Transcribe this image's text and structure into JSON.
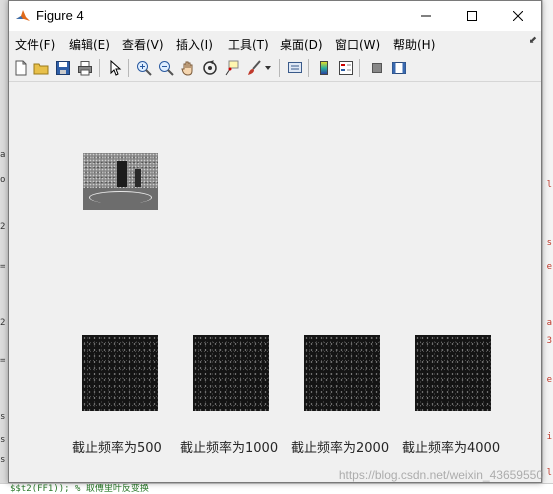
{
  "window": {
    "title": "Figure 4"
  },
  "menu": [
    {
      "label": "文件(F)"
    },
    {
      "label": "编辑(E)"
    },
    {
      "label": "查看(V)"
    },
    {
      "label": "插入(I)"
    },
    {
      "label": "工具(T)"
    },
    {
      "label": "桌面(D)"
    },
    {
      "label": "窗口(W)"
    },
    {
      "label": "帮助(H)"
    }
  ],
  "toolbar": [
    {
      "icon": "new-figure-icon"
    },
    {
      "icon": "open-file-icon"
    },
    {
      "icon": "save-icon"
    },
    {
      "icon": "print-icon"
    },
    {
      "icon": "edit-plot-pointer-icon"
    },
    {
      "icon": "zoom-in-icon"
    },
    {
      "icon": "zoom-out-icon"
    },
    {
      "icon": "pan-hand-icon"
    },
    {
      "icon": "rotate-3d-icon"
    },
    {
      "icon": "data-cursor-icon"
    },
    {
      "icon": "brush-icon"
    },
    {
      "icon": "link-plot-icon"
    },
    {
      "icon": "colorbar-icon"
    },
    {
      "icon": "legend-icon"
    },
    {
      "icon": "hide-plot-tools-icon"
    },
    {
      "icon": "show-plot-tools-icon"
    }
  ],
  "subplots": {
    "captions": [
      "截止频率为500",
      "截止频率为1000",
      "截止频率为2000",
      "截止频率为4000"
    ]
  },
  "watermark": "https://blog.csdn.net/weixin_43659550",
  "background": {
    "bottom_code": "  $$t2(FF1)); % 取傅里叶反变换"
  }
}
